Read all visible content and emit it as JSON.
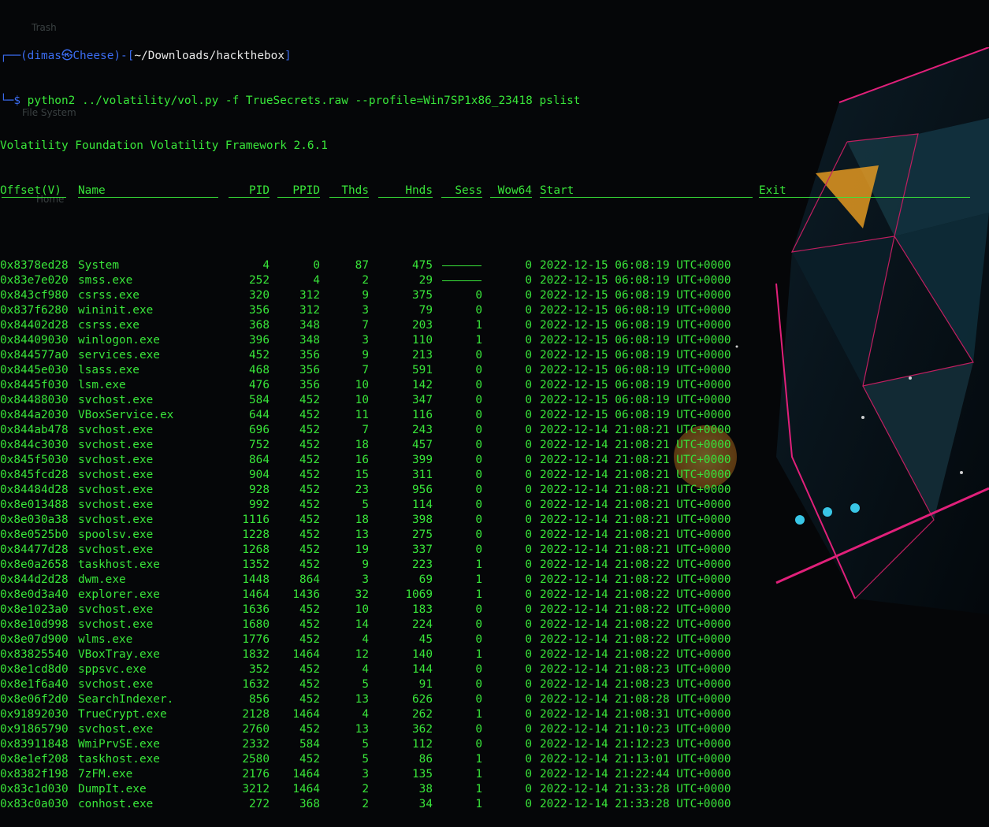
{
  "prompt": {
    "open": "┌──(",
    "user": "dimas",
    "at": "㉿",
    "host": "Cheese",
    "mid": ")-[",
    "path": "~/Downloads/hackthebox",
    "close": "]",
    "cmd_prefix": "└─$ ",
    "command": "python2 ../volatility/vol.py -f TrueSecrets.raw --profile=Win7SP1x86_23418 pslist"
  },
  "banner": "Volatility Foundation Volatility Framework 2.6.1",
  "desktop_ghosts": [
    "Trash",
    "File System",
    "Home"
  ],
  "columns": [
    "Offset(V)",
    "Name",
    "PID",
    "PPID",
    "Thds",
    "Hnds",
    "Sess",
    "Wow64",
    "Start",
    "Exit"
  ],
  "rows": [
    [
      "0x8378ed28",
      "System",
      "4",
      "0",
      "87",
      "475",
      "------",
      "0",
      "2022-12-15 06:08:19 UTC+0000"
    ],
    [
      "0x83e7e020",
      "smss.exe",
      "252",
      "4",
      "2",
      "29",
      "------",
      "0",
      "2022-12-15 06:08:19 UTC+0000"
    ],
    [
      "0x843cf980",
      "csrss.exe",
      "320",
      "312",
      "9",
      "375",
      "0",
      "0",
      "2022-12-15 06:08:19 UTC+0000"
    ],
    [
      "0x837f6280",
      "wininit.exe",
      "356",
      "312",
      "3",
      "79",
      "0",
      "0",
      "2022-12-15 06:08:19 UTC+0000"
    ],
    [
      "0x84402d28",
      "csrss.exe",
      "368",
      "348",
      "7",
      "203",
      "1",
      "0",
      "2022-12-15 06:08:19 UTC+0000"
    ],
    [
      "0x84409030",
      "winlogon.exe",
      "396",
      "348",
      "3",
      "110",
      "1",
      "0",
      "2022-12-15 06:08:19 UTC+0000"
    ],
    [
      "0x844577a0",
      "services.exe",
      "452",
      "356",
      "9",
      "213",
      "0",
      "0",
      "2022-12-15 06:08:19 UTC+0000"
    ],
    [
      "0x8445e030",
      "lsass.exe",
      "468",
      "356",
      "7",
      "591",
      "0",
      "0",
      "2022-12-15 06:08:19 UTC+0000"
    ],
    [
      "0x8445f030",
      "lsm.exe",
      "476",
      "356",
      "10",
      "142",
      "0",
      "0",
      "2022-12-15 06:08:19 UTC+0000"
    ],
    [
      "0x84488030",
      "svchost.exe",
      "584",
      "452",
      "10",
      "347",
      "0",
      "0",
      "2022-12-15 06:08:19 UTC+0000"
    ],
    [
      "0x844a2030",
      "VBoxService.ex",
      "644",
      "452",
      "11",
      "116",
      "0",
      "0",
      "2022-12-15 06:08:19 UTC+0000"
    ],
    [
      "0x844ab478",
      "svchost.exe",
      "696",
      "452",
      "7",
      "243",
      "0",
      "0",
      "2022-12-14 21:08:21 UTC+0000"
    ],
    [
      "0x844c3030",
      "svchost.exe",
      "752",
      "452",
      "18",
      "457",
      "0",
      "0",
      "2022-12-14 21:08:21 UTC+0000"
    ],
    [
      "0x845f5030",
      "svchost.exe",
      "864",
      "452",
      "16",
      "399",
      "0",
      "0",
      "2022-12-14 21:08:21 UTC+0000"
    ],
    [
      "0x845fcd28",
      "svchost.exe",
      "904",
      "452",
      "15",
      "311",
      "0",
      "0",
      "2022-12-14 21:08:21 UTC+0000"
    ],
    [
      "0x84484d28",
      "svchost.exe",
      "928",
      "452",
      "23",
      "956",
      "0",
      "0",
      "2022-12-14 21:08:21 UTC+0000"
    ],
    [
      "0x8e013488",
      "svchost.exe",
      "992",
      "452",
      "5",
      "114",
      "0",
      "0",
      "2022-12-14 21:08:21 UTC+0000"
    ],
    [
      "0x8e030a38",
      "svchost.exe",
      "1116",
      "452",
      "18",
      "398",
      "0",
      "0",
      "2022-12-14 21:08:21 UTC+0000"
    ],
    [
      "0x8e0525b0",
      "spoolsv.exe",
      "1228",
      "452",
      "13",
      "275",
      "0",
      "0",
      "2022-12-14 21:08:21 UTC+0000"
    ],
    [
      "0x84477d28",
      "svchost.exe",
      "1268",
      "452",
      "19",
      "337",
      "0",
      "0",
      "2022-12-14 21:08:21 UTC+0000"
    ],
    [
      "0x8e0a2658",
      "taskhost.exe",
      "1352",
      "452",
      "9",
      "223",
      "1",
      "0",
      "2022-12-14 21:08:22 UTC+0000"
    ],
    [
      "0x844d2d28",
      "dwm.exe",
      "1448",
      "864",
      "3",
      "69",
      "1",
      "0",
      "2022-12-14 21:08:22 UTC+0000"
    ],
    [
      "0x8e0d3a40",
      "explorer.exe",
      "1464",
      "1436",
      "32",
      "1069",
      "1",
      "0",
      "2022-12-14 21:08:22 UTC+0000"
    ],
    [
      "0x8e1023a0",
      "svchost.exe",
      "1636",
      "452",
      "10",
      "183",
      "0",
      "0",
      "2022-12-14 21:08:22 UTC+0000"
    ],
    [
      "0x8e10d998",
      "svchost.exe",
      "1680",
      "452",
      "14",
      "224",
      "0",
      "0",
      "2022-12-14 21:08:22 UTC+0000"
    ],
    [
      "0x8e07d900",
      "wlms.exe",
      "1776",
      "452",
      "4",
      "45",
      "0",
      "0",
      "2022-12-14 21:08:22 UTC+0000"
    ],
    [
      "0x83825540",
      "VBoxTray.exe",
      "1832",
      "1464",
      "12",
      "140",
      "1",
      "0",
      "2022-12-14 21:08:22 UTC+0000"
    ],
    [
      "0x8e1cd8d0",
      "sppsvc.exe",
      "352",
      "452",
      "4",
      "144",
      "0",
      "0",
      "2022-12-14 21:08:23 UTC+0000"
    ],
    [
      "0x8e1f6a40",
      "svchost.exe",
      "1632",
      "452",
      "5",
      "91",
      "0",
      "0",
      "2022-12-14 21:08:23 UTC+0000"
    ],
    [
      "0x8e06f2d0",
      "SearchIndexer.",
      "856",
      "452",
      "13",
      "626",
      "0",
      "0",
      "2022-12-14 21:08:28 UTC+0000"
    ],
    [
      "0x91892030",
      "TrueCrypt.exe",
      "2128",
      "1464",
      "4",
      "262",
      "1",
      "0",
      "2022-12-14 21:08:31 UTC+0000"
    ],
    [
      "0x91865790",
      "svchost.exe",
      "2760",
      "452",
      "13",
      "362",
      "0",
      "0",
      "2022-12-14 21:10:23 UTC+0000"
    ],
    [
      "0x83911848",
      "WmiPrvSE.exe",
      "2332",
      "584",
      "5",
      "112",
      "0",
      "0",
      "2022-12-14 21:12:23 UTC+0000"
    ],
    [
      "0x8e1ef208",
      "taskhost.exe",
      "2580",
      "452",
      "5",
      "86",
      "1",
      "0",
      "2022-12-14 21:13:01 UTC+0000"
    ],
    [
      "0x8382f198",
      "7zFM.exe",
      "2176",
      "1464",
      "3",
      "135",
      "1",
      "0",
      "2022-12-14 21:22:44 UTC+0000"
    ],
    [
      "0x83c1d030",
      "DumpIt.exe",
      "3212",
      "1464",
      "2",
      "38",
      "1",
      "0",
      "2022-12-14 21:33:28 UTC+0000"
    ],
    [
      "0x83c0a030",
      "conhost.exe",
      "272",
      "368",
      "2",
      "34",
      "1",
      "0",
      "2022-12-14 21:33:28 UTC+0000"
    ]
  ]
}
